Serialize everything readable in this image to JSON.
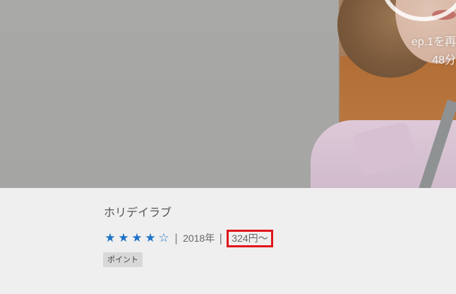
{
  "hero": {
    "play_label": "ep.1を再",
    "duration": "48分"
  },
  "title": "ホリデイラブ",
  "rating": {
    "value": 4,
    "max": 5,
    "stars": [
      "★",
      "★",
      "★",
      "★",
      "☆"
    ]
  },
  "separator": "|",
  "year": "2018年",
  "price": "324円〜",
  "badge": "ポイント",
  "colors": {
    "star": "#1d73c6",
    "highlight": "#e0161c",
    "background": "#efefef"
  }
}
